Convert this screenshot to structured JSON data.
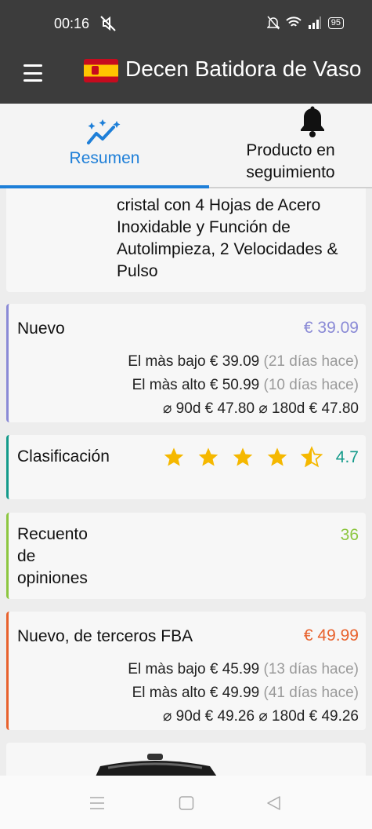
{
  "status": {
    "time": "00:16",
    "battery": "95"
  },
  "appbar": {
    "title": "Decen Batidora de Vaso"
  },
  "tabs": [
    {
      "label": "Resumen"
    },
    {
      "label": "Producto en seguimiento"
    }
  ],
  "description": "cristal con 4 Hojas de Acero Inoxidable y Función de Autolimpieza, 2 Velocidades & Pulso",
  "nuevo": {
    "label": "Nuevo",
    "price": "€ 39.09",
    "lowest": "El màs bajo € 39.09",
    "lowest_ago": "(21 días hace)",
    "highest": "El màs alto € 50.99",
    "highest_ago": "(10 días hace)",
    "avg": "⌀ 90d € 47.80 ⌀ 180d € 47.80",
    "color": "#8a8ad6"
  },
  "rating": {
    "label": "Clasificación",
    "value": "4.7",
    "stars": 4.7,
    "color": "#139a8a"
  },
  "reviews": {
    "label": "Recuento de opiniones",
    "value": "36",
    "color": "#8cc63f"
  },
  "fba": {
    "label": "Nuevo, de terceros FBA",
    "price": "€ 49.99",
    "lowest": "El màs bajo € 45.99",
    "lowest_ago": "(13 días hace)",
    "highest": "El màs alto € 49.99",
    "highest_ago": "(41 días hace)",
    "avg": "⌀ 90d € 49.26 ⌀ 180d € 49.26",
    "color": "#e8612c"
  }
}
